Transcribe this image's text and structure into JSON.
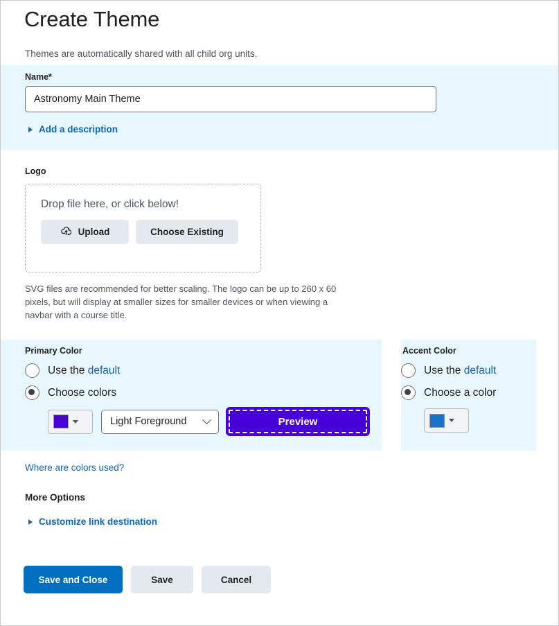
{
  "page": {
    "title": "Create Theme",
    "intro": "Themes are automatically shared with all child org units."
  },
  "name_field": {
    "label": "Name",
    "required_mark": "*",
    "value": "Astronomy Main Theme",
    "placeholder": "",
    "description_toggle": "Add a description"
  },
  "logo": {
    "label": "Logo",
    "dropzone_text": "Drop file here, or click below!",
    "upload_label": "Upload",
    "upload_icon": "cloud-upload-icon",
    "choose_existing_label": "Choose Existing",
    "help_text": "SVG files are recommended for better scaling. The logo can be up to 260 x 60 pixels, but will display at smaller sizes for smaller devices or when viewing a navbar with a course title."
  },
  "primary_color": {
    "title": "Primary Color",
    "option_default_prefix": "Use the ",
    "option_default_link": "default",
    "option_choose": "Choose colors",
    "selected": "choose",
    "swatch_color": "#4800d8",
    "foreground_select_value": "Light Foreground",
    "preview_label": "Preview",
    "preview_bg": "#4800d8"
  },
  "accent_color": {
    "title": "Accent Color",
    "option_default_prefix": "Use the ",
    "option_default_link": "default",
    "option_choose": "Choose a color",
    "selected": "choose",
    "swatch_color": "#1a73c8"
  },
  "links": {
    "where_are_colors_used": "Where are colors used?",
    "more_options": "More Options",
    "customize_link_destination": "Customize link destination"
  },
  "footer": {
    "save_and_close": "Save and Close",
    "save": "Save",
    "cancel": "Cancel"
  }
}
